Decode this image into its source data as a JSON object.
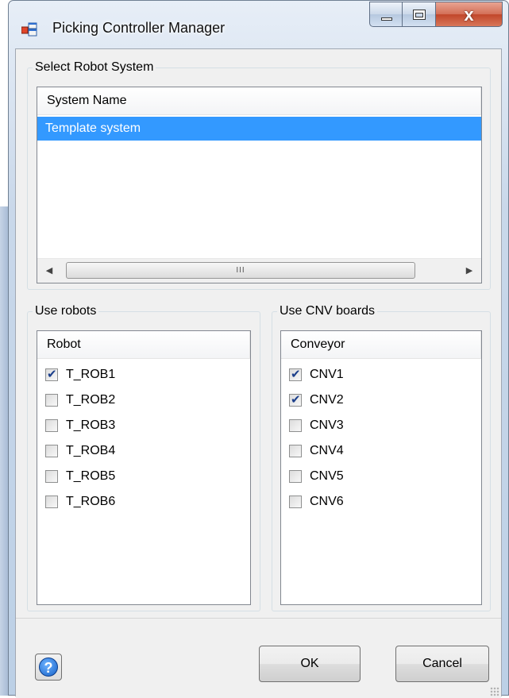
{
  "window": {
    "title": "Picking Controller Manager"
  },
  "caption_buttons": {
    "close_glyph": "x"
  },
  "robot_system": {
    "group_label": "Select Robot System",
    "column_header": "System Name",
    "rows": [
      "Template system"
    ],
    "scroll_thumb_glyph": "III"
  },
  "robots": {
    "group_label": "Use robots",
    "column_header": "Robot",
    "items": [
      {
        "label": "T_ROB1",
        "checked": true
      },
      {
        "label": "T_ROB2",
        "checked": false
      },
      {
        "label": "T_ROB3",
        "checked": false
      },
      {
        "label": "T_ROB4",
        "checked": false
      },
      {
        "label": "T_ROB5",
        "checked": false
      },
      {
        "label": "T_ROB6",
        "checked": false
      }
    ]
  },
  "conveyors": {
    "group_label": "Use CNV boards",
    "column_header": "Conveyor",
    "items": [
      {
        "label": "CNV1",
        "checked": true
      },
      {
        "label": "CNV2",
        "checked": true
      },
      {
        "label": "CNV3",
        "checked": false
      },
      {
        "label": "CNV4",
        "checked": false
      },
      {
        "label": "CNV5",
        "checked": false
      },
      {
        "label": "CNV6",
        "checked": false
      }
    ]
  },
  "buttons": {
    "help_glyph": "?",
    "ok_label": "OK",
    "cancel_label": "Cancel"
  },
  "colors": {
    "selection": "#3399ff",
    "check_mark": "#1c3f8b",
    "close_button": "#c1462a"
  }
}
